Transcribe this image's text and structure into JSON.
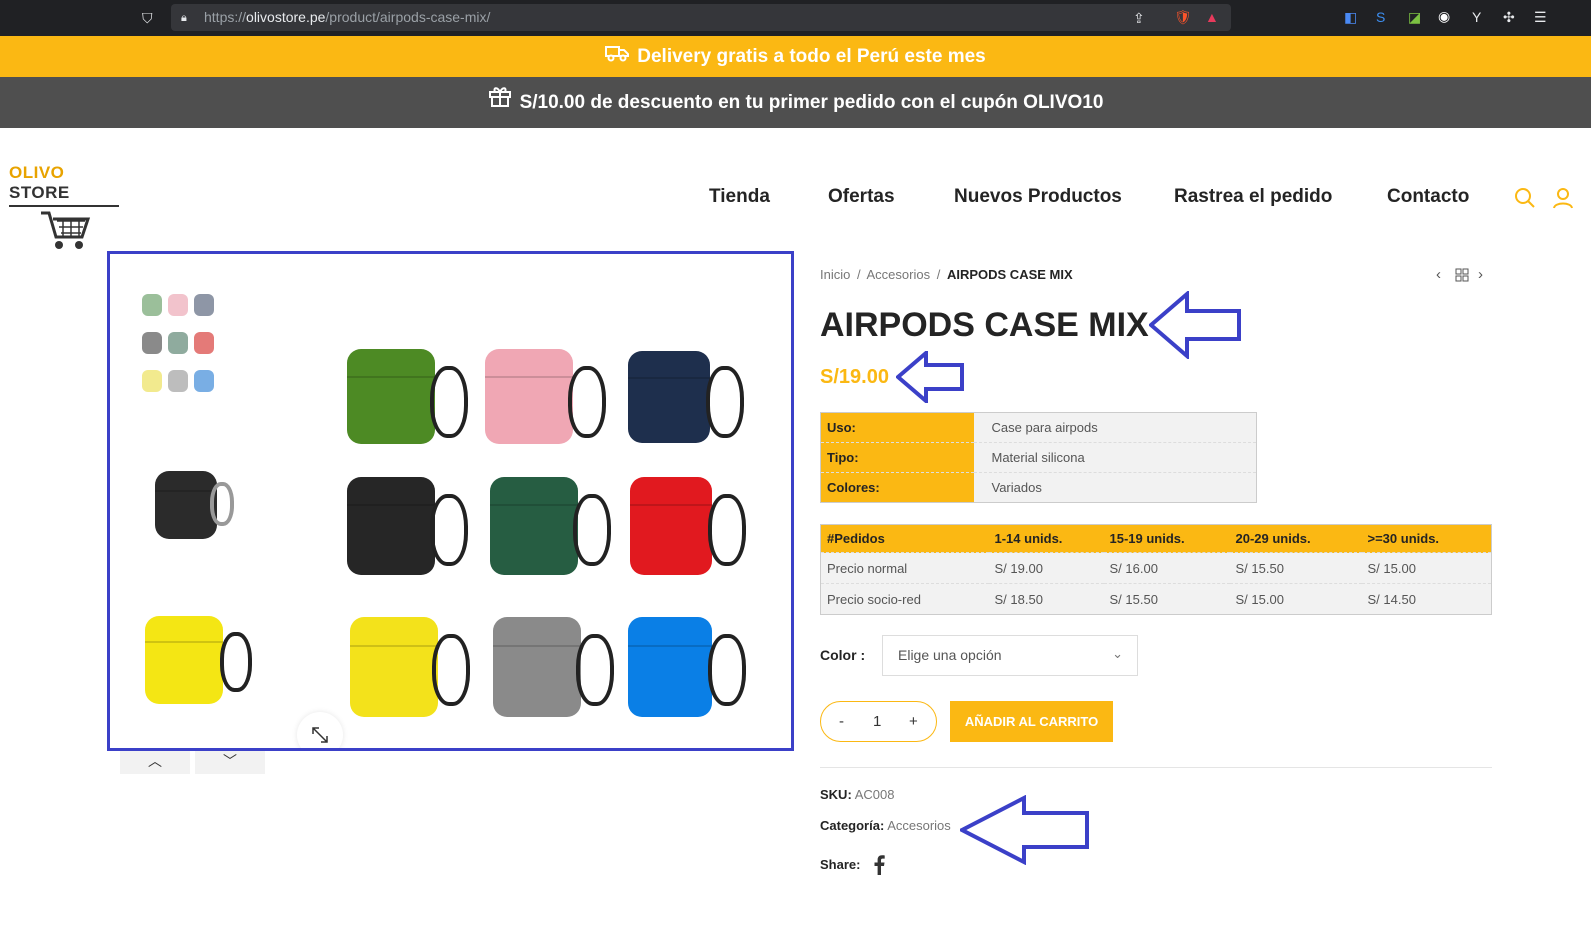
{
  "browser": {
    "url_prefix": "https://",
    "url_domain": "olivostore.pe",
    "url_path": "/product/airpods-case-mix/"
  },
  "banners": {
    "delivery": "Delivery gratis a todo el Perú este mes",
    "coupon": "S/10.00 de descuento en tu primer pedido con el cupón OLIVO10"
  },
  "logo": {
    "part1": "OLIVO",
    "part2": " STORE"
  },
  "nav": [
    "Tienda",
    "Ofertas",
    "Nuevos Productos",
    "Rastrea el pedido",
    "Contacto"
  ],
  "breadcrumb": {
    "home": "Inicio",
    "sep": "/",
    "category": "Accesorios",
    "current": "AIRPODS CASE MIX"
  },
  "product": {
    "title": "AIRPODS CASE MIX",
    "price": "S/19.00",
    "specs": [
      {
        "key": "Uso:",
        "value": "Case para airpods"
      },
      {
        "key": "Tipo:",
        "value": "Material silicona"
      },
      {
        "key": "Colores:",
        "value": "Variados"
      }
    ],
    "pricing": {
      "headers": [
        "#Pedidos",
        "1-14 unids.",
        "15-19 unids.",
        "20-29 unids.",
        ">=30 unids."
      ],
      "rows": [
        [
          "Precio normal",
          "S/ 19.00",
          "S/ 16.00",
          "S/ 15.50",
          "S/ 15.00"
        ],
        [
          "Precio socio-red",
          "S/ 18.50",
          "S/ 15.50",
          "S/ 15.00",
          "S/ 14.50"
        ]
      ]
    },
    "color_label": "Color :",
    "color_placeholder": "Elige una opción",
    "qty_minus": "-",
    "qty_value": "1",
    "qty_plus": "+",
    "add_to_cart": "AÑADIR AL CARRITO",
    "sku_label": "SKU:",
    "sku": "AC008",
    "category_label": "Categoría:",
    "category": "Accesorios",
    "share_label": "Share:"
  },
  "colors": {
    "accent": "#fbb813",
    "dark_bar": "#4f4f4f",
    "annotation": "#3b40c8"
  }
}
